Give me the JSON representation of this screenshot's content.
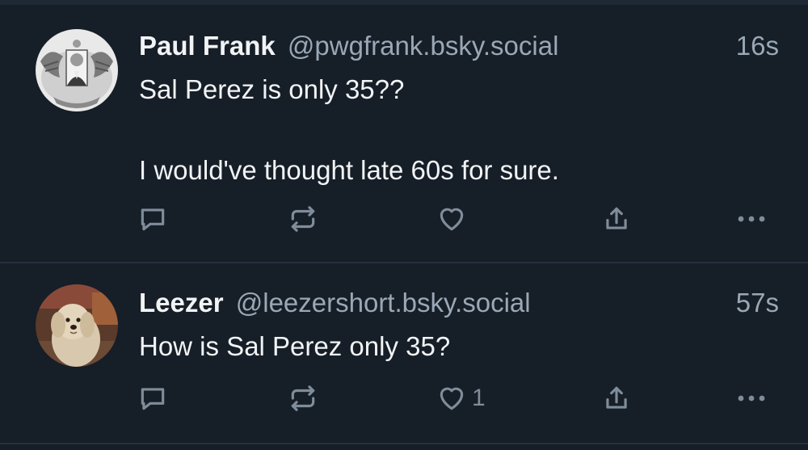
{
  "posts": [
    {
      "author_name": "Paul Frank",
      "author_handle": "@pwgfrank.bsky.social",
      "timestamp": "16s",
      "text": "Sal Perez is only 35??\n\nI would've thought late 60s for sure.",
      "like_count": ""
    },
    {
      "author_name": "Leezer",
      "author_handle": "@leezershort.bsky.social",
      "timestamp": "57s",
      "text": "How is Sal Perez only 35?",
      "like_count": "1"
    }
  ],
  "icons": {
    "reply": "reply-icon",
    "repost": "repost-icon",
    "like": "heart-icon",
    "share": "share-icon",
    "more": "more-icon"
  },
  "colors": {
    "background": "#161e27",
    "text": "#f1f3f5",
    "muted": "#9aa7b5",
    "icon": "#7f8c9a",
    "divider": "#25313f"
  }
}
